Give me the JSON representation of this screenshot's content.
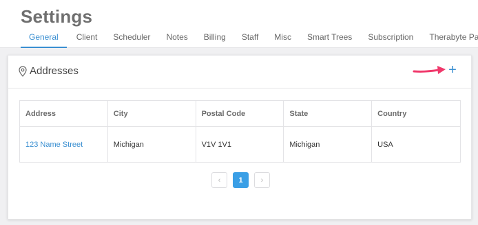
{
  "header": {
    "title": "Settings",
    "tabs": [
      "General",
      "Client",
      "Scheduler",
      "Notes",
      "Billing",
      "Staff",
      "Misc",
      "Smart Trees",
      "Subscription",
      "Therabyte Pay"
    ],
    "active_tab": "General"
  },
  "addresses": {
    "title": "Addresses",
    "add_label": "+",
    "columns": [
      "Address",
      "City",
      "Postal Code",
      "State",
      "Country"
    ],
    "rows": [
      [
        "123 Name Street",
        "Michigan",
        "V1V 1V1",
        "Michigan",
        "USA"
      ]
    ]
  },
  "pagination": {
    "prev_label": "‹",
    "current_page": "1",
    "next_label": "›"
  },
  "colors": {
    "accent": "#3a8fd1",
    "annotation_arrow": "#f0386b"
  },
  "icons": {
    "location": "map-pin-icon",
    "annotation": "arrow-right-icon"
  }
}
